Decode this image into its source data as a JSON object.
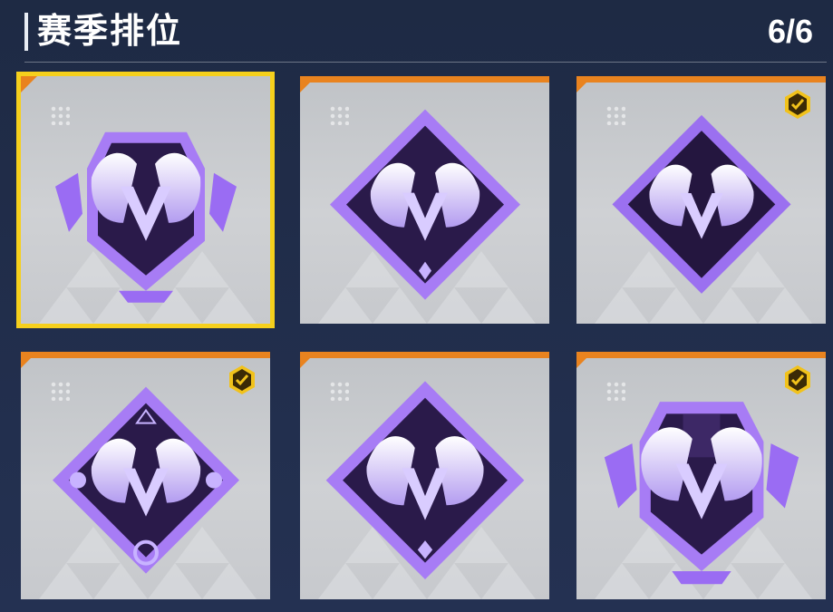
{
  "header": {
    "title": "赛季排位",
    "counter": "6/6"
  },
  "colors": {
    "accent_orange": "#e9831f",
    "selected_outline": "#f6d01c",
    "check_gold": "#f1c21b",
    "emblem_purple": "#8b5cf6",
    "emblem_dark": "#2a1a4a"
  },
  "items": [
    {
      "emblem": "winged-v-shield-emblem",
      "selected": true,
      "owned_check": false
    },
    {
      "emblem": "winged-v-diamond-emblem",
      "selected": false,
      "owned_check": false
    },
    {
      "emblem": "winged-v-diamond-emblem",
      "selected": false,
      "owned_check": true
    },
    {
      "emblem": "winged-v-ornate-diamond-emblem",
      "selected": false,
      "owned_check": true
    },
    {
      "emblem": "winged-v-diamond-emblem",
      "selected": false,
      "owned_check": false
    },
    {
      "emblem": "winged-v-shield-emblem",
      "selected": false,
      "owned_check": true
    }
  ]
}
